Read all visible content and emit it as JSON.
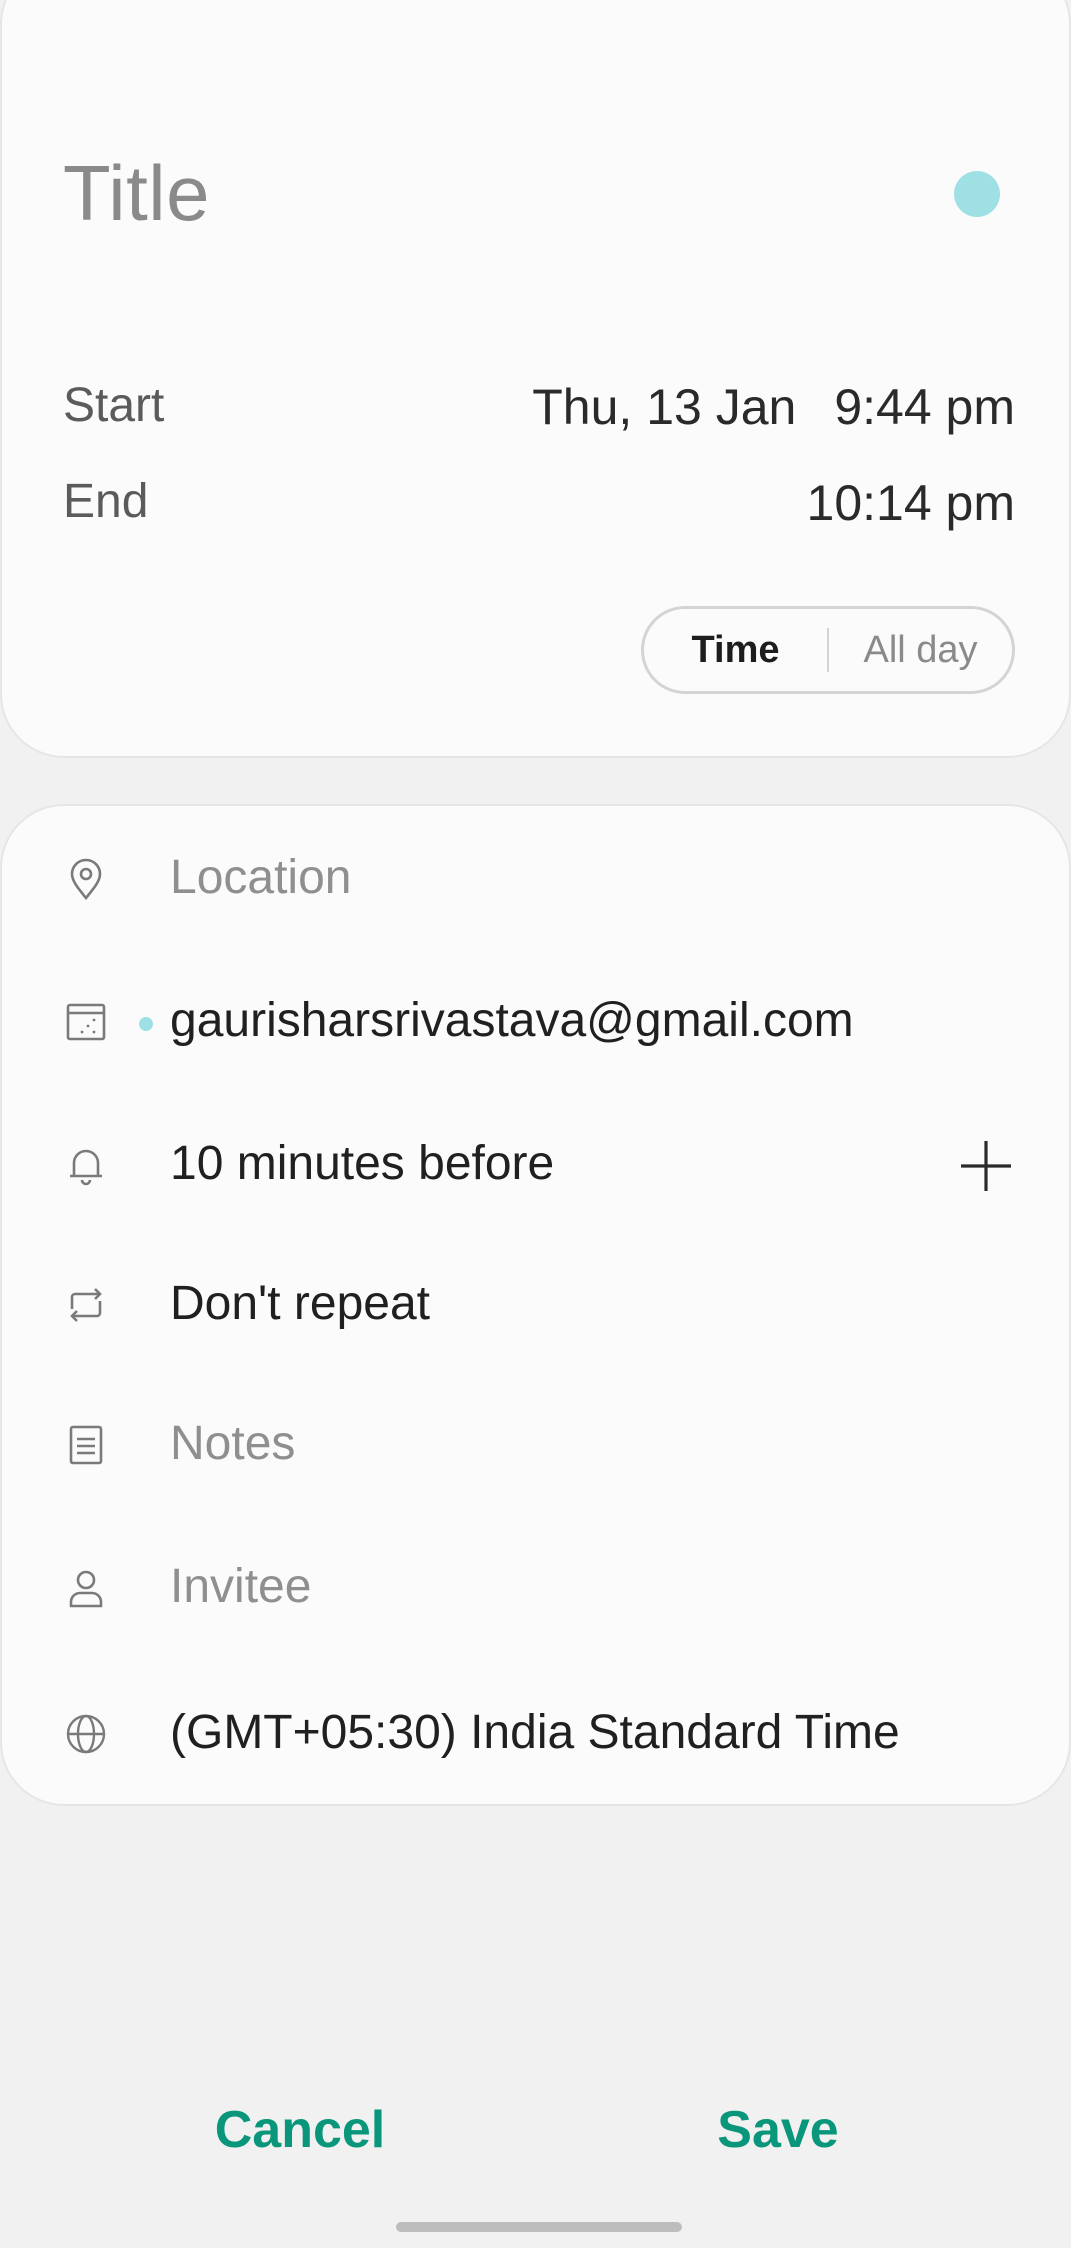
{
  "colors": {
    "accent": "#0a967a",
    "event_color": "#9fe0e4",
    "calendar_dot": "#9fe0e4"
  },
  "event": {
    "title_placeholder": "Title",
    "start_label": "Start",
    "end_label": "End",
    "start_date": "Thu, 13 Jan",
    "start_time": "9:44 pm",
    "end_time": "10:14 pm",
    "toggle": {
      "time_label": "Time",
      "allday_label": "All day",
      "selected": "Time"
    }
  },
  "details": {
    "location_placeholder": "Location",
    "calendar_account": "gaurisharsrivastava@gmail.com",
    "reminder": "10 minutes before",
    "repeat": "Don't repeat",
    "notes_placeholder": "Notes",
    "invitee_placeholder": "Invitee",
    "timezone": "(GMT+05:30) India Standard Time",
    "icons": {
      "location": "location-pin-icon",
      "calendar": "calendar-icon",
      "reminder": "bell-icon",
      "add_reminder": "plus-icon",
      "repeat": "repeat-icon",
      "notes": "notes-icon",
      "invitee": "person-icon",
      "timezone": "globe-icon"
    }
  },
  "actions": {
    "cancel_label": "Cancel",
    "save_label": "Save"
  }
}
